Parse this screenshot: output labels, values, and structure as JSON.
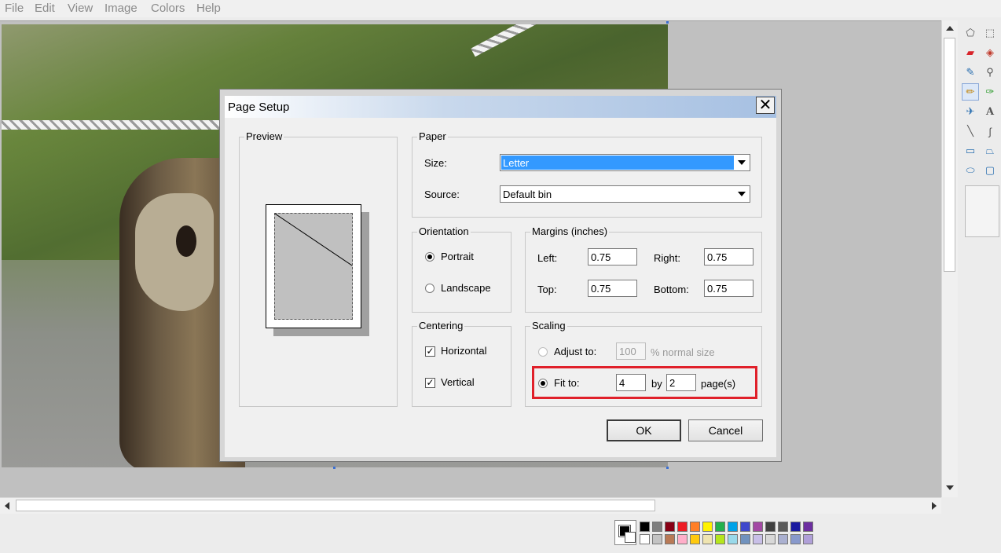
{
  "menu": [
    "File",
    "Edit",
    "View",
    "Image",
    "Colors",
    "Help"
  ],
  "dialog": {
    "title": "Page Setup",
    "close": "✕",
    "preview_label": "Preview",
    "paper": {
      "legend": "Paper",
      "size_label": "Size:",
      "size_value": "Letter",
      "source_label": "Source:",
      "source_value": "Default bin"
    },
    "orientation": {
      "legend": "Orientation",
      "portrait": "Portrait",
      "landscape": "Landscape",
      "selected": "Portrait"
    },
    "margins": {
      "legend": "Margins (inches)",
      "left_label": "Left:",
      "left": "0.75",
      "right_label": "Right:",
      "right": "0.75",
      "top_label": "Top:",
      "top": "0.75",
      "bottom_label": "Bottom:",
      "bottom": "0.75"
    },
    "centering": {
      "legend": "Centering",
      "horizontal": "Horizontal",
      "horizontal_checked": true,
      "vertical": "Vertical",
      "vertical_checked": true
    },
    "scaling": {
      "legend": "Scaling",
      "adjust_label": "Adjust to:",
      "adjust_value": "100",
      "adjust_suffix": "% normal size",
      "fit_label": "Fit to:",
      "fit_wide": "4",
      "by": "by",
      "fit_tall": "2",
      "pages": "page(s)",
      "selected": "Fit to"
    },
    "ok": "OK",
    "cancel": "Cancel"
  },
  "check_mark": "✓",
  "colors": {
    "highlight": "#e0202a",
    "title_gradient_end": "#a6c0e2",
    "selection": "#3399ff"
  },
  "palette": {
    "row1": [
      "#000000",
      "#7f7f7f",
      "#880015",
      "#ed1c24",
      "#ff7f27",
      "#fff200",
      "#22b14c",
      "#00a2e8",
      "#3f48cc",
      "#a349a4",
      "#404040",
      "#5a5a5a",
      "#1a1aa0",
      "#6d2fa0"
    ],
    "row2": [
      "#ffffff",
      "#c3c3c3",
      "#b97a57",
      "#ffaec9",
      "#ffc90e",
      "#efe4b0",
      "#b5e61d",
      "#99d9ea",
      "#7092be",
      "#c8bfe7",
      "#d8d8d8",
      "#aab0d0",
      "#8899cc",
      "#b0a0d8"
    ]
  },
  "tools": [
    "free-select-icon",
    "rect-select-icon",
    "eraser-icon",
    "fill-icon",
    "color-picker-icon",
    "magnifier-icon",
    "pencil-icon",
    "brush-icon",
    "airbrush-icon",
    "text-icon",
    "line-icon",
    "curve-icon",
    "rectangle-icon",
    "polygon-icon",
    "ellipse-icon",
    "rounded-rect-icon"
  ]
}
